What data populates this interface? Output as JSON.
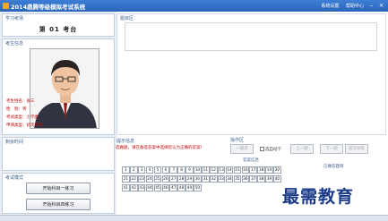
{
  "window": {
    "title": "2014鼎腾等级模拟考试系统",
    "menu": [
      "系统设置",
      "帮助中心"
    ],
    "controls": [
      "–",
      "×"
    ]
  },
  "panels": {
    "exam_seat_title": "学习考场",
    "candidate_info_title": "考生信息",
    "remaining_time_title": "剩余时间",
    "exam_mode_title": "考试模式",
    "question_area_title": "题目区",
    "hint_title": "提示信息",
    "operation_title": "操作区",
    "answer_info_title": "答案信息",
    "completed_title": "已做答题目"
  },
  "seat": {
    "label": "第 01 考台"
  },
  "candidate": {
    "name": "考生姓名：张三",
    "gender": "性　别：男",
    "exam_type": "考试类型：小学类",
    "apply_type": "申请类型：初次申请"
  },
  "hint": {
    "text": "选做题，请在备选答案中选择您认为正确的答案！"
  },
  "operation": {
    "first_button": "一题示",
    "auto_next_label": "选自动下",
    "prev_button": "上一题",
    "next_button": "下一题",
    "submit_button": "提交试卷"
  },
  "question_numbers": [
    1,
    2,
    3,
    4,
    5,
    6,
    7,
    8,
    9,
    10,
    11,
    12,
    13,
    14,
    15,
    16,
    17,
    18,
    19,
    20,
    21,
    22,
    23,
    24,
    25,
    26,
    27,
    28,
    29,
    30,
    31,
    32,
    33,
    34,
    35,
    36,
    37,
    38,
    39,
    40,
    41,
    42,
    43,
    44,
    45,
    46,
    47,
    48,
    49,
    50
  ],
  "modes": {
    "practice_one_by_one": "开始科目一练习",
    "practice_four": "开始科目四练习"
  },
  "watermark": "最需教育",
  "colors": {
    "titlebar": "#2a64b8",
    "hint_text": "#c00000",
    "panel_border": "#c3cfdd",
    "watermark": "#1a3a8a"
  }
}
